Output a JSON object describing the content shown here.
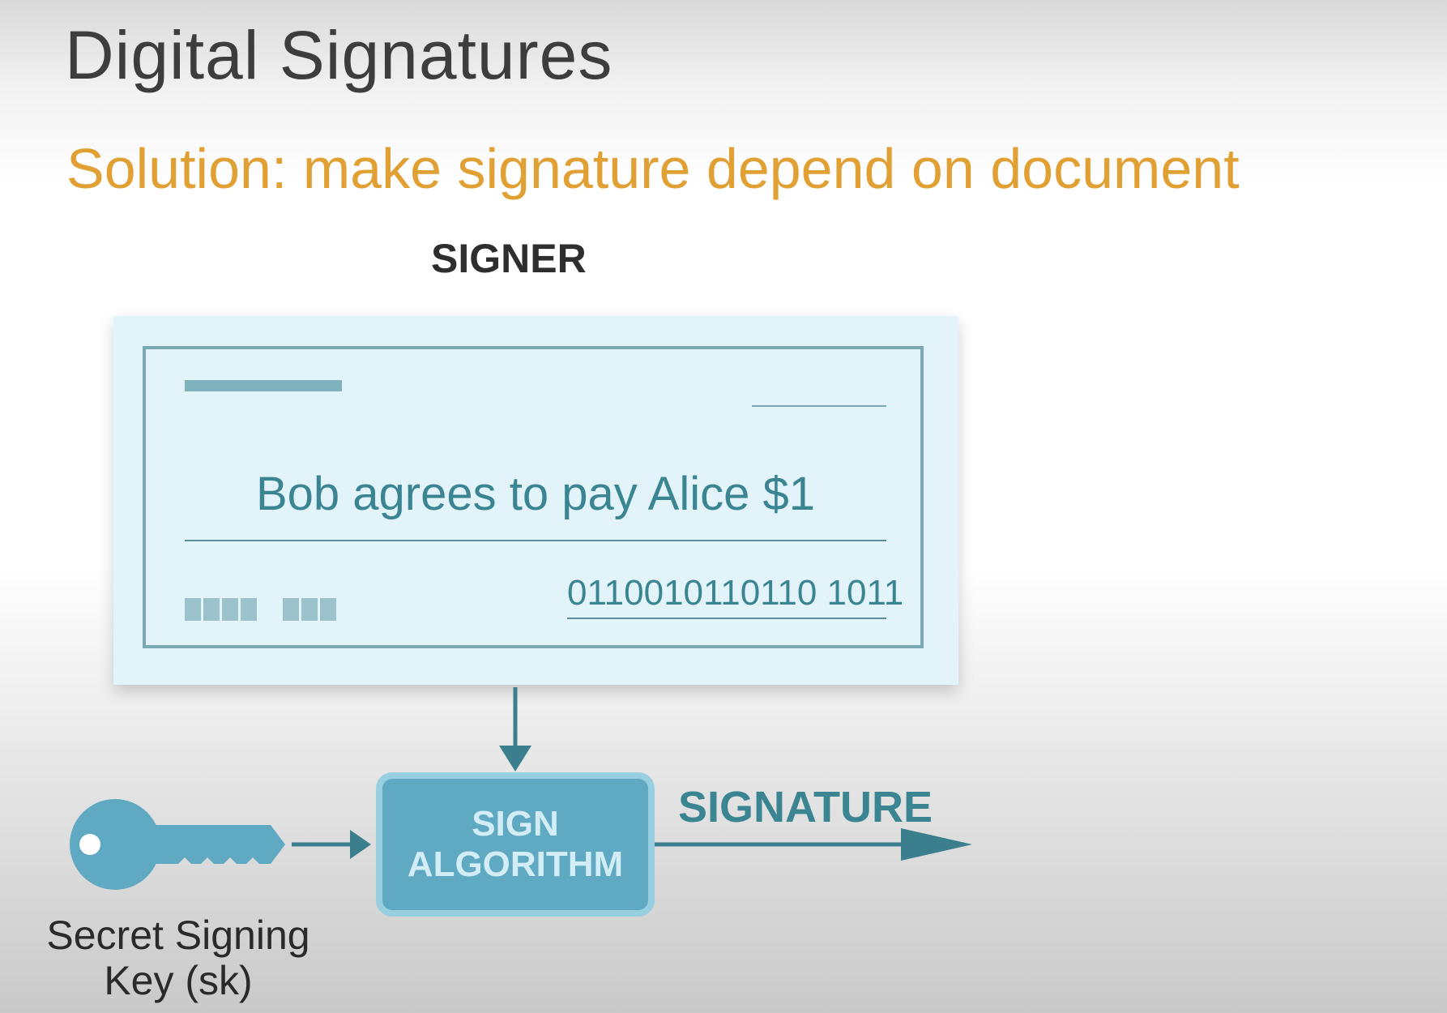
{
  "slide": {
    "title": "Digital Signatures",
    "subtitle": "Solution: make signature depend on document"
  },
  "signer": {
    "label": "SIGNER"
  },
  "document": {
    "text": "Bob agrees to pay Alice $1",
    "binary": "0110010110110 1011"
  },
  "sign_algorithm": {
    "line1": "SIGN",
    "line2": "ALGORITHM"
  },
  "signature": {
    "label": "SIGNATURE"
  },
  "key": {
    "label_line1": "Secret Signing",
    "label_line2": "Key (sk)",
    "icon": "key-icon"
  },
  "colors": {
    "title": "#3d3d3d",
    "subtitle": "#e0a033",
    "teal": "#3b8593",
    "document_bg": "#e2f3f9",
    "key": "#5fa9c2"
  }
}
